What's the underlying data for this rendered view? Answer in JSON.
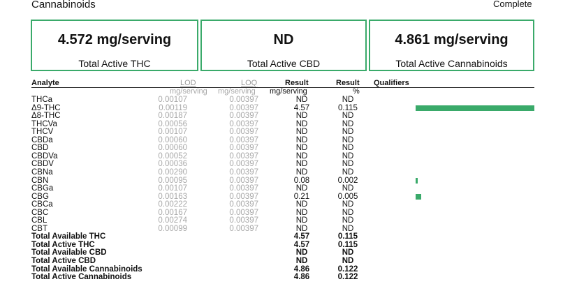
{
  "header": {
    "title": "Cannabinoids",
    "status": "Complete"
  },
  "summary": [
    {
      "value": "4.572 mg/serving",
      "label": "Total Active THC"
    },
    {
      "value": "ND",
      "label": "Total Active CBD"
    },
    {
      "value": "4.861 mg/serving",
      "label": "Total Active Cannabinoids"
    }
  ],
  "table": {
    "headers": {
      "analyte": "Analyte",
      "lod": "LOD",
      "loq": "LOQ",
      "result": "Result",
      "result_pct": "Result",
      "qualifiers": "Qualifiers"
    },
    "units": {
      "lod": "mg/serving",
      "loq": "mg/serving",
      "result": "mg/serving",
      "result_pct": "%"
    },
    "rows": [
      {
        "name": "THCa",
        "lod": "0.00107",
        "loq": "0.00397",
        "result": "ND",
        "pct": "ND",
        "bar_fraction": 0
      },
      {
        "name": "Δ9-THC",
        "lod": "0.00119",
        "loq": "0.00397",
        "result": "4.57",
        "pct": "0.115",
        "bar_fraction": 1
      },
      {
        "name": "Δ8-THC",
        "lod": "0.00187",
        "loq": "0.00397",
        "result": "ND",
        "pct": "ND",
        "bar_fraction": 0
      },
      {
        "name": "THCVa",
        "lod": "0.00056",
        "loq": "0.00397",
        "result": "ND",
        "pct": "ND",
        "bar_fraction": 0
      },
      {
        "name": "THCV",
        "lod": "0.00107",
        "loq": "0.00397",
        "result": "ND",
        "pct": "ND",
        "bar_fraction": 0
      },
      {
        "name": "CBDa",
        "lod": "0.00060",
        "loq": "0.00397",
        "result": "ND",
        "pct": "ND",
        "bar_fraction": 0
      },
      {
        "name": "CBD",
        "lod": "0.00060",
        "loq": "0.00397",
        "result": "ND",
        "pct": "ND",
        "bar_fraction": 0
      },
      {
        "name": "CBDVa",
        "lod": "0.00052",
        "loq": "0.00397",
        "result": "ND",
        "pct": "ND",
        "bar_fraction": 0
      },
      {
        "name": "CBDV",
        "lod": "0.00036",
        "loq": "0.00397",
        "result": "ND",
        "pct": "ND",
        "bar_fraction": 0
      },
      {
        "name": "CBNa",
        "lod": "0.00290",
        "loq": "0.00397",
        "result": "ND",
        "pct": "ND",
        "bar_fraction": 0
      },
      {
        "name": "CBN",
        "lod": "0.00095",
        "loq": "0.00397",
        "result": "0.08",
        "pct": "0.002",
        "bar_fraction": 0.017
      },
      {
        "name": "CBGa",
        "lod": "0.00107",
        "loq": "0.00397",
        "result": "ND",
        "pct": "ND",
        "bar_fraction": 0
      },
      {
        "name": "CBG",
        "lod": "0.00163",
        "loq": "0.00397",
        "result": "0.21",
        "pct": "0.005",
        "bar_fraction": 0.046
      },
      {
        "name": "CBCa",
        "lod": "0.00222",
        "loq": "0.00397",
        "result": "ND",
        "pct": "ND",
        "bar_fraction": 0
      },
      {
        "name": "CBC",
        "lod": "0.00167",
        "loq": "0.00397",
        "result": "ND",
        "pct": "ND",
        "bar_fraction": 0
      },
      {
        "name": "CBL",
        "lod": "0.00274",
        "loq": "0.00397",
        "result": "ND",
        "pct": "ND",
        "bar_fraction": 0
      },
      {
        "name": "CBT",
        "lod": "0.00099",
        "loq": "0.00397",
        "result": "ND",
        "pct": "ND",
        "bar_fraction": 0
      }
    ],
    "totals": [
      {
        "name": "Total Available THC",
        "result": "4.57",
        "pct": "0.115"
      },
      {
        "name": "Total Active THC",
        "result": "4.57",
        "pct": "0.115"
      },
      {
        "name": "Total Available CBD",
        "result": "ND",
        "pct": "ND"
      },
      {
        "name": "Total Active CBD",
        "result": "ND",
        "pct": "ND"
      },
      {
        "name": "Total Available Cannabinoids",
        "result": "4.86",
        "pct": "0.122"
      },
      {
        "name": "Total Active Cannabinoids",
        "result": "4.86",
        "pct": "0.122"
      }
    ]
  },
  "colors": {
    "accent": "#3aaa6a"
  }
}
